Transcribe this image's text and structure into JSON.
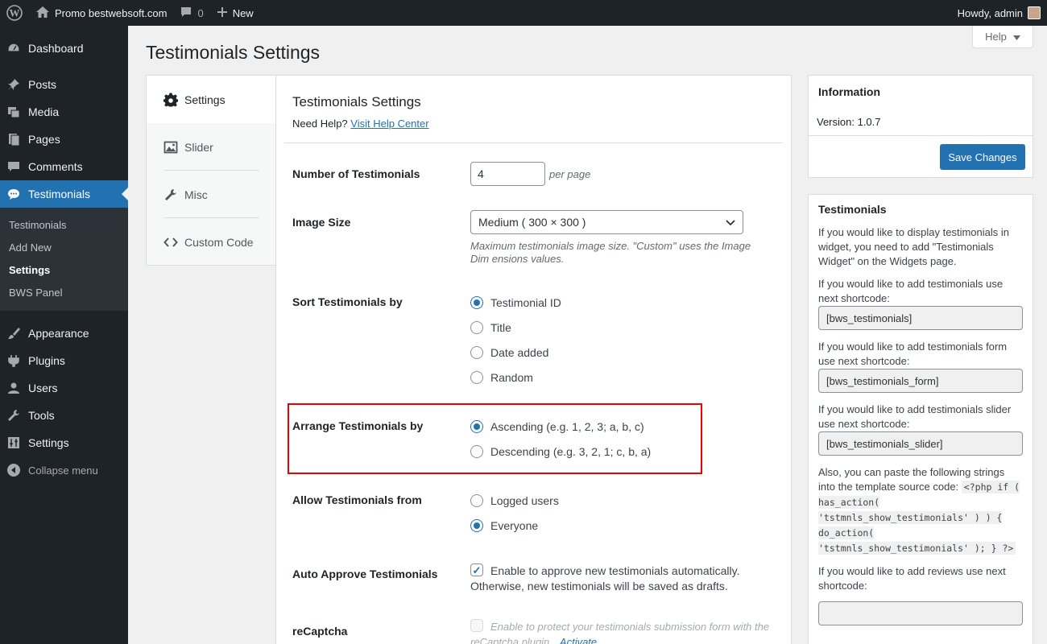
{
  "adminbar": {
    "site_name": "Promo bestwebsoft.com",
    "comments_count": "0",
    "new_label": "New",
    "greeting": "Howdy, admin"
  },
  "sidebar": {
    "items": [
      {
        "label": "Dashboard"
      },
      {
        "label": "Posts"
      },
      {
        "label": "Media"
      },
      {
        "label": "Pages"
      },
      {
        "label": "Comments"
      },
      {
        "label": "Testimonials"
      }
    ],
    "submenu": [
      "Testimonials",
      "Add New",
      "Settings",
      "BWS Panel"
    ],
    "items_after": [
      {
        "label": "Appearance"
      },
      {
        "label": "Plugins"
      },
      {
        "label": "Users"
      },
      {
        "label": "Tools"
      },
      {
        "label": "Settings"
      }
    ],
    "collapse_label": "Collapse menu"
  },
  "help_tab": {
    "label": "Help"
  },
  "page_title": "Testimonials Settings",
  "tabs": [
    {
      "label": "Settings",
      "icon": "gear-icon"
    },
    {
      "label": "Slider",
      "icon": "image-icon"
    },
    {
      "label": "Misc",
      "icon": "wrench-icon"
    },
    {
      "label": "Custom Code",
      "icon": "code-icon"
    }
  ],
  "main": {
    "title": "Testimonials Settings",
    "need_help": "Need Help?",
    "help_link": "Visit Help Center",
    "number_label": "Number of Testimonials",
    "number_value": "4",
    "per_page": "per page",
    "image_size_label": "Image Size",
    "image_size_value": "Medium ( 300 × 300 )",
    "image_size_desc": "Maximum testimonials image size. \"Custom\" uses the Image Dim ensions values.",
    "sort_label": "Sort Testimonials by",
    "sort_options": [
      "Testimonial ID",
      "Title",
      "Date added",
      "Random"
    ],
    "sort_selected": "Testimonial ID",
    "arrange_label": "Arrange Testimonials by",
    "arrange_options": [
      "Ascending (e.g. 1, 2, 3; a, b, c)",
      "Descending (e.g. 3, 2, 1; c, b, a)"
    ],
    "arrange_selected": "Ascending (e.g. 1, 2, 3; a, b, c)",
    "allow_label": "Allow Testimonials from",
    "allow_options": [
      "Logged users",
      "Everyone"
    ],
    "allow_selected": "Everyone",
    "auto_approve_label": "Auto Approve Testimonials",
    "auto_approve_line1": "Enable to approve new testimonials automatically.",
    "auto_approve_line2": "Otherwise, new testimonials will be saved as drafts.",
    "recaptcha_label": "reCaptcha",
    "recaptcha_text1": "Enable to protect your testimonials submission form with the",
    "recaptcha_text2": "reCaptcha plugin.",
    "recaptcha_link": "Activate"
  },
  "info_box": {
    "title": "Information",
    "version": "Version: 1.0.7",
    "save_label": "Save Changes"
  },
  "testimonials_box": {
    "title": "Testimonials",
    "p1": "If you would like to display testimonials in widget, you need to add \"Testimonials Widget\" on the Widgets page.",
    "p2": "If you would like to add testimonials use next shortcode:",
    "code1": "[bws_testimonials]",
    "p3": "If you would like to add testimonials form use next shortcode:",
    "code2": "[bws_testimonials_form]",
    "p4": "If you would like to add testimonials slider use next shortcode:",
    "code3": "[bws_testimonials_slider]",
    "p5": "Also, you can paste the following strings into the template source code:",
    "php_code": "<?php if ( has_action( 'tstmnls_show_testimonials' ) ) { do_action( 'tstmnls_show_testimonials' ); } ?>",
    "p6": "If you would like to add reviews use next shortcode:"
  },
  "colors": {
    "accent": "#2271b1",
    "admin_bg": "#1d2327",
    "highlight": "#ee0000"
  }
}
